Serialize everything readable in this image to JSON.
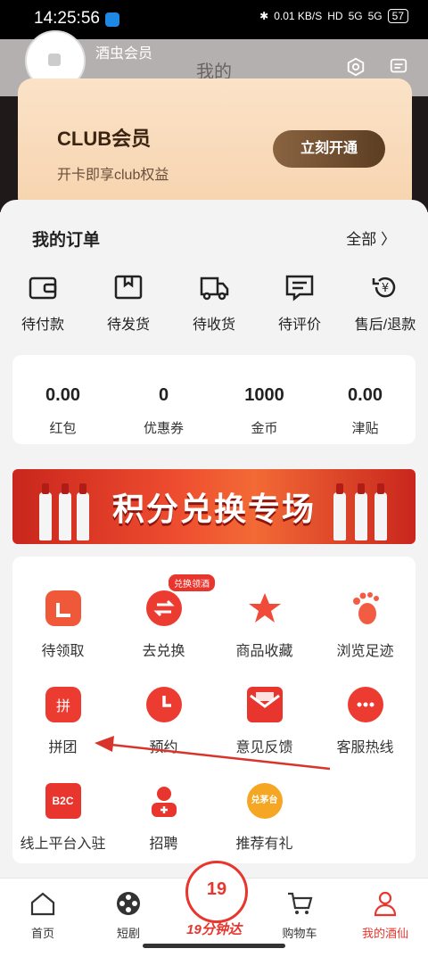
{
  "status": {
    "time": "14:25:56",
    "net_speed": "0.01 KB/S",
    "hd": "HD",
    "sig1": "5G",
    "sig2": "5G",
    "battery": "57"
  },
  "header": {
    "member_label": "酒虫会员",
    "title": "我的"
  },
  "club": {
    "title": "CLUB会员",
    "subtitle": "开卡即享club权益",
    "button": "立刻开通"
  },
  "orders": {
    "title": "我的订单",
    "all": "全部 〉",
    "items": [
      {
        "label": "待付款",
        "icon": "wallet-icon"
      },
      {
        "label": "待发货",
        "icon": "box-icon"
      },
      {
        "label": "待收货",
        "icon": "truck-icon"
      },
      {
        "label": "待评价",
        "icon": "comment-icon"
      },
      {
        "label": "售后/退款",
        "icon": "refund-icon"
      }
    ]
  },
  "stats": [
    {
      "value": "0.00",
      "label": "红包"
    },
    {
      "value": "0",
      "label": "优惠券"
    },
    {
      "value": "1000",
      "label": "金币"
    },
    {
      "value": "0.00",
      "label": "津贴"
    }
  ],
  "banner": {
    "text": "积分兑换专场"
  },
  "services": [
    {
      "label": "待领取",
      "icon": "gift-box-icon",
      "color": "#f0583a"
    },
    {
      "label": "去兑换",
      "icon": "exchange-icon",
      "color": "#ec3b30",
      "badge": "兑换领酒"
    },
    {
      "label": "商品收藏",
      "icon": "star-icon",
      "color": "#f04a38"
    },
    {
      "label": "浏览足迹",
      "icon": "footprint-icon",
      "color": "#f25c43"
    },
    {
      "label": "拼团",
      "icon": "group-buy-icon",
      "color": "#ec3b30"
    },
    {
      "label": "预约",
      "icon": "clock-icon",
      "color": "#ec3b30"
    },
    {
      "label": "意见反馈",
      "icon": "mail-icon",
      "color": "#e8352d"
    },
    {
      "label": "客服热线",
      "icon": "chat-bubble-icon",
      "color": "#ec3b30"
    },
    {
      "label": "线上平台入驻",
      "icon": "b2c-icon",
      "color": "#e8352d",
      "icon_text": "B2C"
    },
    {
      "label": "招聘",
      "icon": "person-add-icon",
      "color": "#e8352d"
    },
    {
      "label": "推荐有礼",
      "icon": "maotai-badge-icon",
      "color": "#f5a623",
      "icon_text": "兑茅台"
    }
  ],
  "tabs": [
    {
      "label": "首页",
      "icon": "home-icon"
    },
    {
      "label": "短剧",
      "icon": "film-reel-icon"
    },
    {
      "label": "19分钟达",
      "icon": "delivery-19-icon",
      "badge_text": "19"
    },
    {
      "label": "购物车",
      "icon": "cart-icon"
    },
    {
      "label": "我的酒仙",
      "icon": "profile-icon"
    }
  ],
  "colors": {
    "accent": "#e8352d",
    "club_bg": "#f6d3ae",
    "club_button": "#6b4a2d"
  }
}
